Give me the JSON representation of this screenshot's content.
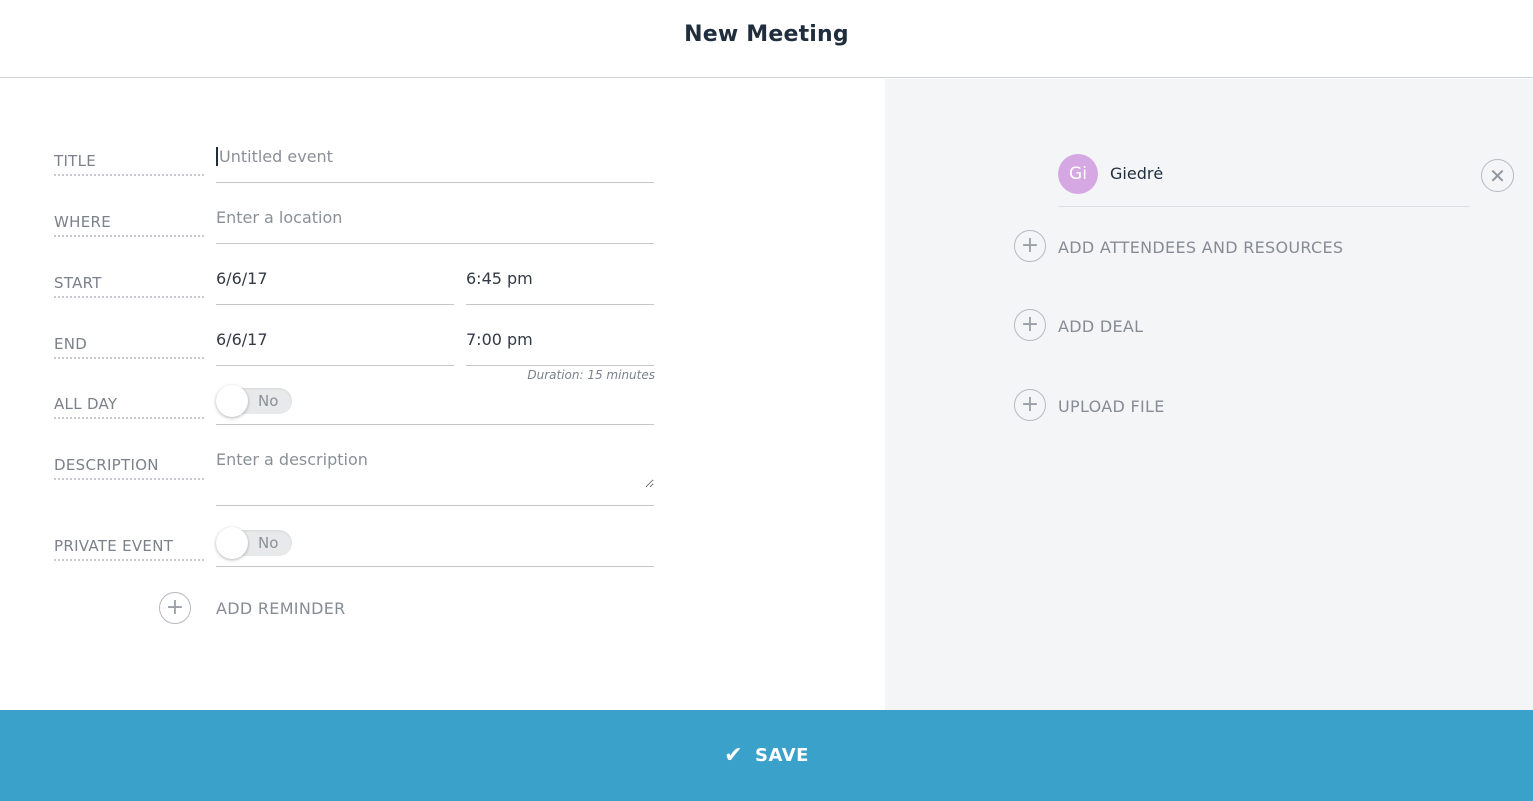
{
  "header": {
    "title": "New Meeting"
  },
  "form": {
    "title": {
      "label": "TITLE",
      "placeholder": "Untitled event",
      "value": ""
    },
    "where": {
      "label": "WHERE",
      "placeholder": "Enter a location",
      "value": ""
    },
    "start": {
      "label": "START",
      "date": "6/6/17",
      "time": "6:45 pm"
    },
    "end": {
      "label": "END",
      "date": "6/6/17",
      "time": "7:00 pm"
    },
    "duration": "Duration: 15 minutes",
    "all_day": {
      "label": "ALL DAY",
      "state": "No"
    },
    "description": {
      "label": "DESCRIPTION",
      "placeholder": "Enter a description",
      "value": ""
    },
    "private_event": {
      "label": "PRIVATE EVENT",
      "state": "No"
    },
    "add_reminder": "ADD REMINDER"
  },
  "side": {
    "attendee": {
      "initials": "Gi",
      "name": "Giedrė",
      "avatar_color": "#d6a8e3"
    },
    "add_attendees": "ADD ATTENDEES AND RESOURCES",
    "add_deal": "ADD DEAL",
    "upload_file": "UPLOAD FILE"
  },
  "footer": {
    "save_label": "SAVE"
  },
  "colors": {
    "accent": "#3aa1ca",
    "side_background": "#f4f5f7"
  },
  "icons": {
    "plus": "+",
    "close": "✕",
    "check": "✔"
  }
}
